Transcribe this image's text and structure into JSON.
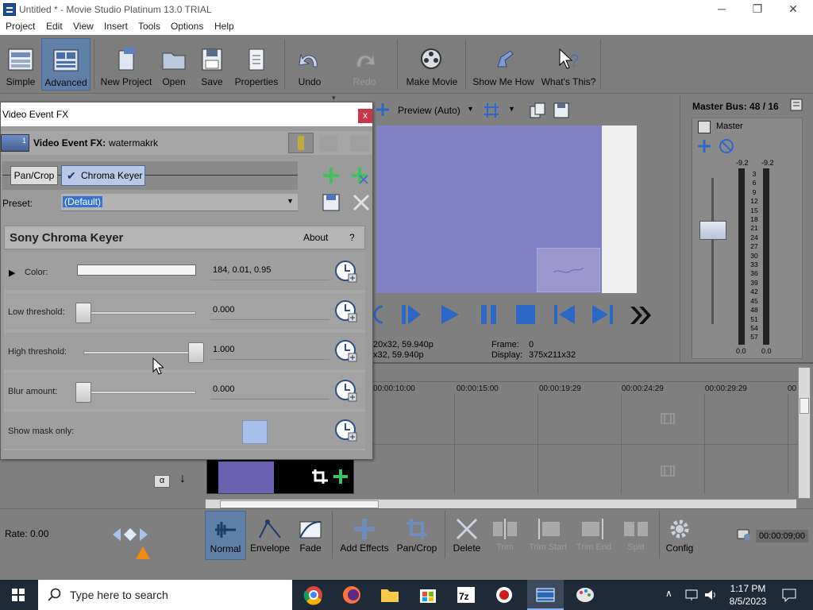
{
  "window": {
    "title": "Untitled * - Movie Studio Platinum 13.0 TRIAL",
    "min": "─",
    "max": "❐",
    "close": "✕"
  },
  "menu": [
    "Project",
    "Edit",
    "View",
    "Insert",
    "Tools",
    "Options",
    "Help"
  ],
  "toolbar": {
    "simple": "Simple",
    "advanced": "Advanced",
    "new_project": "New Project",
    "open": "Open",
    "save": "Save",
    "properties": "Properties",
    "undo": "Undo",
    "redo": "Redo",
    "make_movie": "Make Movie",
    "show_me_how": "Show Me How",
    "whats_this": "What's This?"
  },
  "preview": {
    "quality": "Preview (Auto)",
    "frame_label": "Frame:",
    "frame_value": "0",
    "display_label": "Display:",
    "display_value": "375x211x32",
    "info1": "20x32, 59.940p",
    "info2": "x32, 59.940p"
  },
  "master": {
    "title": "Master Bus: 48 / 16",
    "label": "Master",
    "peak_l": "-9.2",
    "peak_r": "-9.2",
    "scale": [
      "3",
      "6",
      "9",
      "12",
      "15",
      "18",
      "21",
      "24",
      "27",
      "30",
      "33",
      "36",
      "39",
      "42",
      "45",
      "48",
      "51",
      "54",
      "57"
    ],
    "bottom_l": "0.0",
    "bottom_r": "0.0"
  },
  "fx": {
    "title": "Video Event FX",
    "close": "x",
    "header_label": "Video Event FX:",
    "header_name": "watermakrk",
    "badge": "1",
    "chain_pan": "Pan/Crop",
    "chain_key": "Chroma Keyer",
    "preset_label": "Preset:",
    "preset_value": "(Default)",
    "plugin_title": "Sony Chroma Keyer",
    "about": "About",
    "help": "?",
    "params": {
      "color_label": "Color:",
      "color_value": "184, 0.01, 0.95",
      "low_label": "Low threshold:",
      "low_value": "0.000",
      "high_label": "High threshold:",
      "high_value": "1.000",
      "blur_label": "Blur amount:",
      "blur_value": "0.000",
      "mask_label": "Show mask only:"
    },
    "sliders": {
      "low": 0.0,
      "high": 1.0,
      "blur": 0.0
    },
    "swatch_color": "#f5f5f5"
  },
  "timeline": {
    "ticks": [
      "00:00:10:00",
      "00:00:15:00",
      "00:00:19:29",
      "00:00:24:29",
      "00:00:29:29",
      "00"
    ],
    "alpha": "α"
  },
  "bottom": {
    "rate": "Rate: 0.00",
    "normal": "Normal",
    "envelope": "Envelope",
    "fade": "Fade",
    "add_effects": "Add Effects",
    "pan_crop": "Pan/Crop",
    "delete": "Delete",
    "trim": "Trim",
    "trim_start": "Trim Start",
    "trim_end": "Trim End",
    "split": "Split",
    "config": "Config",
    "timecode": "00:00:09;00"
  },
  "taskbar": {
    "search": "Type here to search",
    "time": "1:17 PM",
    "date": "8/5/2023"
  },
  "colors": {
    "accent_blue": "#1e5fbf",
    "preview_purple": "#8181c6",
    "orange": "#f08a12"
  }
}
